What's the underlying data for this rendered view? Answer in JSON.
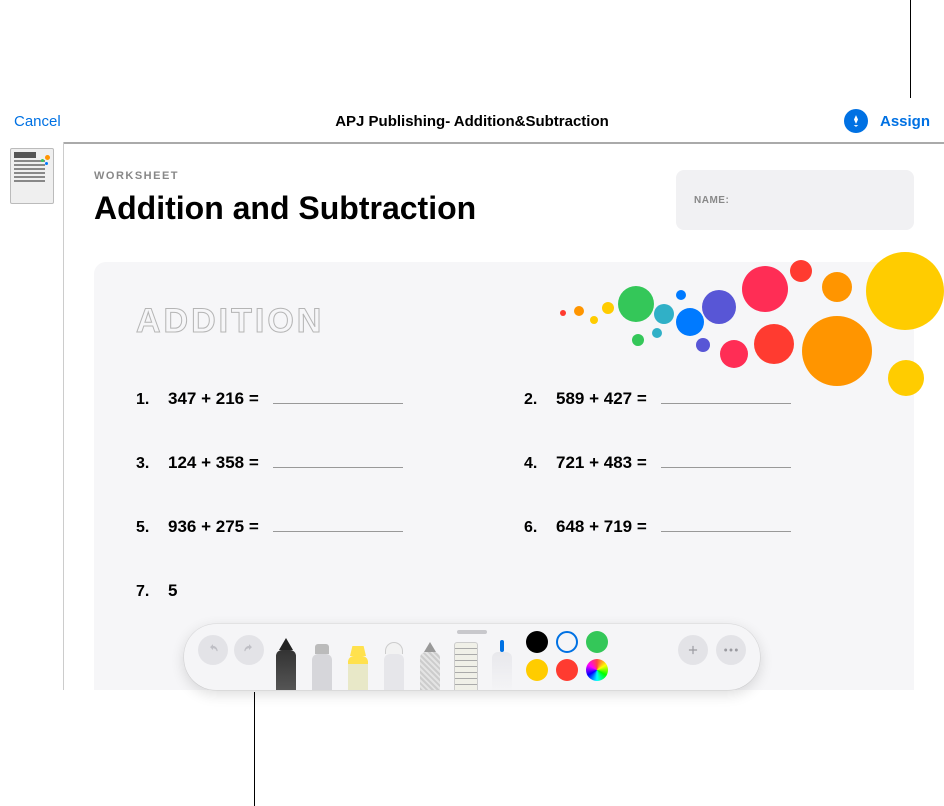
{
  "header": {
    "cancel": "Cancel",
    "title": "APJ Publishing- Addition&Subtraction",
    "assign": "Assign"
  },
  "document": {
    "eyebrow": "WORKSHEET",
    "title": "Addition and Subtraction",
    "name_label": "NAME:",
    "section_heading": "ADDITION",
    "problems": [
      {
        "n": "1.",
        "expr": "347 + 216 ="
      },
      {
        "n": "2.",
        "expr": "589 + 427 ="
      },
      {
        "n": "3.",
        "expr": "124 + 358 ="
      },
      {
        "n": "4.",
        "expr": "721 + 483 ="
      },
      {
        "n": "5.",
        "expr": "936 + 275 ="
      },
      {
        "n": "6.",
        "expr": "648 + 719 ="
      },
      {
        "n": "7.",
        "expr": "5"
      }
    ]
  },
  "toolbar": {
    "undo": "↶",
    "redo": "↷",
    "tools": [
      "pen",
      "marker",
      "highlighter",
      "eraser",
      "pencil",
      "ruler",
      "lasso"
    ],
    "colors": {
      "black": "#000000",
      "blue": "#0071e3",
      "green": "#34c759",
      "yellow": "#ffcc00",
      "red": "#ff3b30"
    },
    "add": "＋",
    "more": "…"
  },
  "bubble_colors": {
    "orange": "#ff9500",
    "yellow": "#ffcc00",
    "green": "#34c759",
    "teal": "#30b0c7",
    "blue": "#007aff",
    "indigo": "#5856d6",
    "pink": "#ff2d55",
    "red": "#ff3b30",
    "darkorange": "#ff7a00"
  }
}
